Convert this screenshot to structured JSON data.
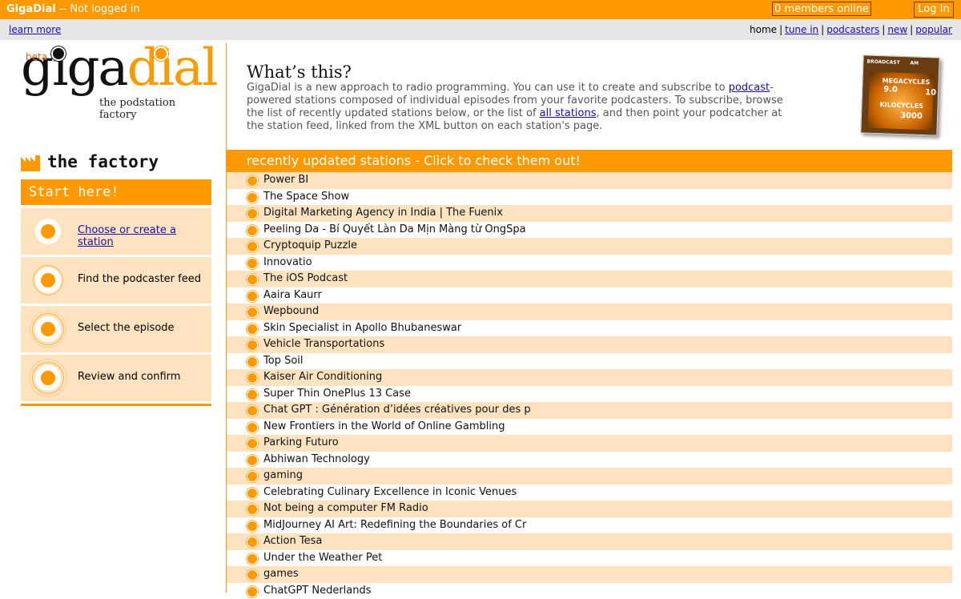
{
  "topbar": {
    "site_name": "GigaDial",
    "status": "-- Not logged in",
    "members_online": "0 members online",
    "login_label": "Log In"
  },
  "subbar": {
    "learn_more": "learn more",
    "nav": [
      "home",
      "tune in",
      "podcasters",
      "new",
      "popular"
    ]
  },
  "logo": {
    "beta": "beta",
    "giga": "giga",
    "dial": "dial",
    "tagline": "the podstation factory"
  },
  "factory": {
    "heading": "the factory",
    "start_label": "Start here!",
    "steps": [
      "Choose or create a station",
      "Find the podcaster feed",
      "Select the episode",
      "Review and confirm"
    ]
  },
  "whats_this": {
    "title": "What’s this?",
    "part1": "GigaDial is a new approach to radio programming. You can use it to create and subscribe to ",
    "link1": "podcast",
    "part2": "-powered stations composed of individual episodes from your favorite podcasters. To subscribe, browse the list of recently updated stations below, or the list of ",
    "link2": "all stations",
    "part3": ", and then point your podcatcher at the station feed, linked from the XML button on each station's page."
  },
  "dial_image": {
    "labels": [
      "BROADCAST",
      "AM",
      "MEGACYCLES",
      "9.0",
      "10",
      "KILOCYCLES",
      "3000"
    ]
  },
  "recent": {
    "heading": "recently updated stations - Click to check them out!",
    "stations": [
      "Power BI",
      "The Space Show",
      "Digital Marketing Agency in India | The Fuenix",
      "Peeling Da - Bí Quyết Làn Da Mịn Màng từ OngSpa",
      "Cryptoquip Puzzle",
      "Innovatio",
      "The iOS Podcast",
      "Aaira Kaurr",
      "Wepbound",
      "Skin Specialist in Apollo Bhubaneswar",
      "Vehicle Transportations",
      "Top Soil",
      "Kaiser Air Conditioning",
      "Super Thin OnePlus 13 Case",
      "Chat GPT : Génération d’idées créatives pour des p",
      "New Frontiers in the World of Online Gambling",
      "Parking Futuro",
      "Abhiwan Technology",
      "gaming",
      "Celebrating Culinary Excellence in Iconic Venues",
      "Not being a computer FM Radio",
      "MidJourney AI Art: Redefining the Boundaries of Cr",
      "Action Tesa",
      "Under the Weather Pet",
      "games",
      "ChatGPT Nederlands"
    ]
  },
  "colors": {
    "accent": "#FF9900",
    "row_alt": "#FDE3BF",
    "link": "#1a0dab"
  }
}
